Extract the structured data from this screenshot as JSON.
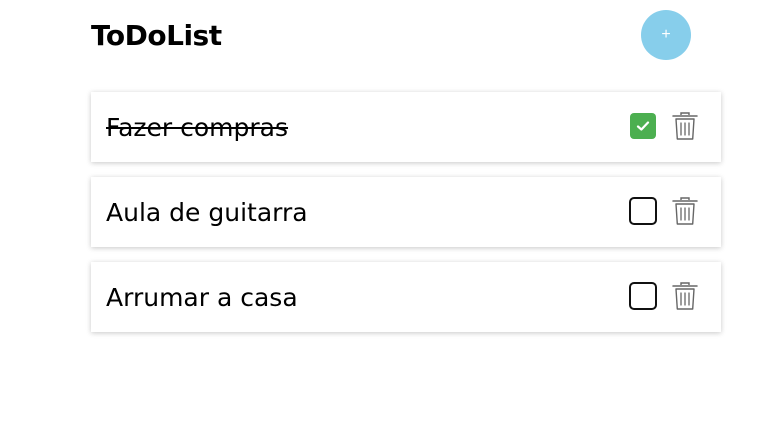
{
  "app": {
    "title": "ToDoList",
    "add_button_label": "+"
  },
  "todos": [
    {
      "text": "Fazer compras",
      "completed": true
    },
    {
      "text": "Aula de guitarra",
      "completed": false
    },
    {
      "text": "Arrumar a casa",
      "completed": false
    }
  ],
  "icons": {
    "checkbox": "checkbox-icon",
    "check": "check-icon",
    "delete": "trash-icon"
  },
  "colors": {
    "add_button": "#87ceeb",
    "checked": "#4caf50",
    "icon_gray": "#666666"
  }
}
